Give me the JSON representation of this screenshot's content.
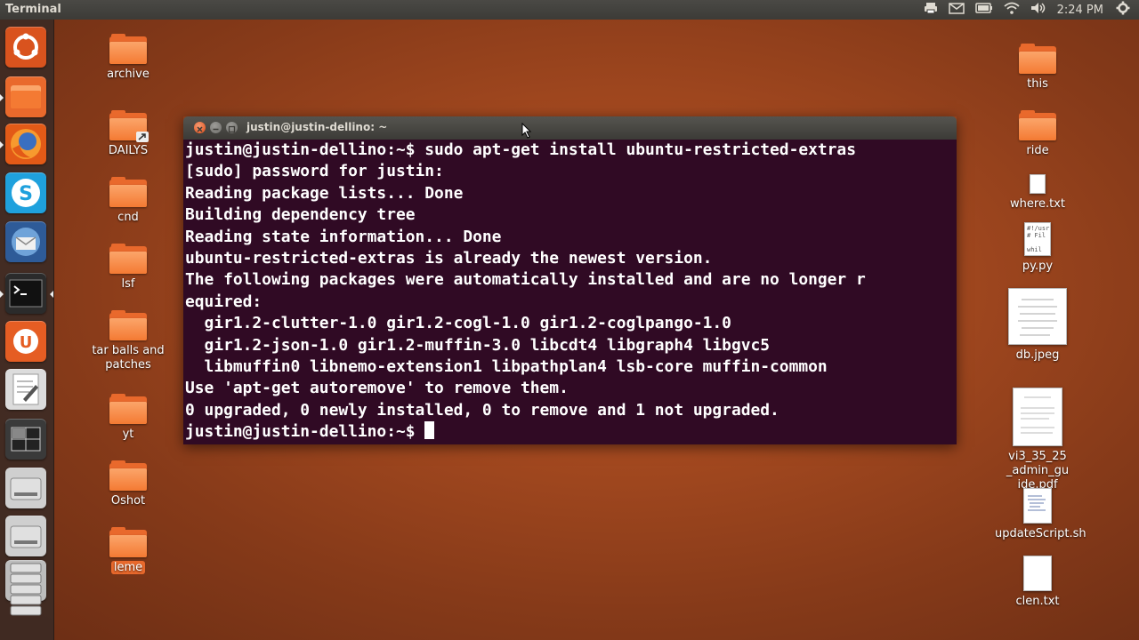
{
  "panel": {
    "app_title": "Terminal",
    "clock": "2:24 PM",
    "indicators": [
      "printer-icon",
      "mail-icon",
      "battery-icon",
      "wifi-icon",
      "volume-icon",
      "power-gear-icon"
    ]
  },
  "launcher": {
    "items": [
      {
        "name": "dash-home-button",
        "color": "#d9531e"
      },
      {
        "name": "files-launcher",
        "color": "#e9692c"
      },
      {
        "name": "firefox-launcher",
        "color": "#e35a17"
      },
      {
        "name": "skype-launcher",
        "color": "#1fa1dd"
      },
      {
        "name": "thunderbird-launcher",
        "color": "#2e5b98"
      },
      {
        "name": "terminal-launcher",
        "color": "#2b2b2b"
      },
      {
        "name": "ubuntu-one-launcher",
        "color": "#e55d23"
      },
      {
        "name": "text-editor-launcher",
        "color": "#dcdcdc"
      },
      {
        "name": "workspace-switcher-launcher",
        "color": "#3a3a3a"
      },
      {
        "name": "drive-1-launcher",
        "color": "#cfcfcf"
      },
      {
        "name": "drive-2-launcher",
        "color": "#cfcfcf"
      },
      {
        "name": "drive-stack-launcher",
        "color": "#bdbdbd"
      }
    ]
  },
  "desktop_left": [
    {
      "label": "archive"
    },
    {
      "label": "DAILYS"
    },
    {
      "label": "cnd"
    },
    {
      "label": "lsf"
    },
    {
      "label": "tar balls and patches"
    },
    {
      "label": "yt"
    },
    {
      "label": "Oshot"
    },
    {
      "label": "leme"
    }
  ],
  "desktop_right": {
    "this": "this",
    "ride": "ride",
    "where": "where.txt",
    "pypy": "py.py",
    "pypy_preview": "#!/usr\n# Fil\n\nwhil",
    "dbjpeg": "db.jpeg",
    "pdf": "vi3_35_25_admin_guide.pdf",
    "update": "updateScript.sh",
    "clen": "clen.txt"
  },
  "terminal": {
    "title": "justin@justin-dellino: ~",
    "bg_color": "#300a24",
    "lines": [
      "justin@justin-dellino:~$ sudo apt-get install ubuntu-restricted-extras",
      "[sudo] password for justin:",
      "Reading package lists... Done",
      "Building dependency tree",
      "Reading state information... Done",
      "ubuntu-restricted-extras is already the newest version.",
      "The following packages were automatically installed and are no longer r",
      "equired:",
      "  gir1.2-clutter-1.0 gir1.2-cogl-1.0 gir1.2-coglpango-1.0",
      "  gir1.2-json-1.0 gir1.2-muffin-3.0 libcdt4 libgraph4 libgvc5",
      "  libmuffin0 libnemo-extension1 libpathplan4 lsb-core muffin-common",
      "Use 'apt-get autoremove' to remove them.",
      "0 upgraded, 0 newly installed, 0 to remove and 1 not upgraded."
    ],
    "prompt": "justin@justin-dellino:~$ "
  }
}
